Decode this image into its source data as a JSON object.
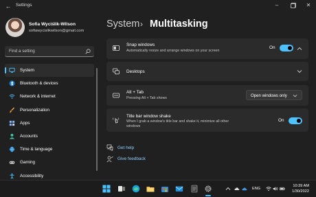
{
  "window": {
    "title": "Settings"
  },
  "profile": {
    "name": "Sofia Wyciślik-Wilson",
    "email": "sofiawycislikwilson@gmail.com"
  },
  "search": {
    "placeholder": "Find a setting"
  },
  "sidebar": {
    "items": [
      {
        "label": "System",
        "icon": "system-icon",
        "color": "#4cc2ff",
        "active": true
      },
      {
        "label": "Bluetooth & devices",
        "icon": "bluetooth-icon",
        "color": "#4cc2ff"
      },
      {
        "label": "Network & internet",
        "icon": "network-icon",
        "color": "#4cc2ff"
      },
      {
        "label": "Personalization",
        "icon": "brush-icon",
        "color": "#f2a23c"
      },
      {
        "label": "Apps",
        "icon": "apps-icon",
        "color": "#8ab4f8"
      },
      {
        "label": "Accounts",
        "icon": "person-icon",
        "color": "#3fc1a5"
      },
      {
        "label": "Time & language",
        "icon": "globe-clock-icon",
        "color": "#4cc2ff"
      },
      {
        "label": "Gaming",
        "icon": "gamepad-icon",
        "color": "#c8c8c8"
      },
      {
        "label": "Accessibility",
        "icon": "accessibility-icon",
        "color": "#4cc2ff"
      }
    ]
  },
  "header": {
    "section": "System",
    "separator": "›",
    "page": "Multitasking"
  },
  "cards": {
    "snap": {
      "title": "Snap windows",
      "subtitle": "Automatically resize and arrange windows on your screen",
      "toggle_label": "On",
      "icon": "snap-icon"
    },
    "desktops": {
      "title": "Desktops",
      "icon": "desktops-icon"
    },
    "alttab": {
      "title": "Alt + Tab",
      "subtitle": "Pressing Alt + Tab shows",
      "selected": "Open windows only",
      "icon": "alt-tab-icon"
    },
    "shake": {
      "title": "Title bar window shake",
      "subtitle_line1": "When I grab a window's title bar and shake it, minimize all other",
      "subtitle_line2": "windows",
      "toggle_label": "On",
      "icon": "shake-icon"
    }
  },
  "help": {
    "get_help": "Get help",
    "feedback": "Give feedback"
  },
  "taskbar": {
    "language": "ENG",
    "time": "10:39 AM",
    "date": "1/30/2022",
    "accent": "#4cc2ff"
  }
}
